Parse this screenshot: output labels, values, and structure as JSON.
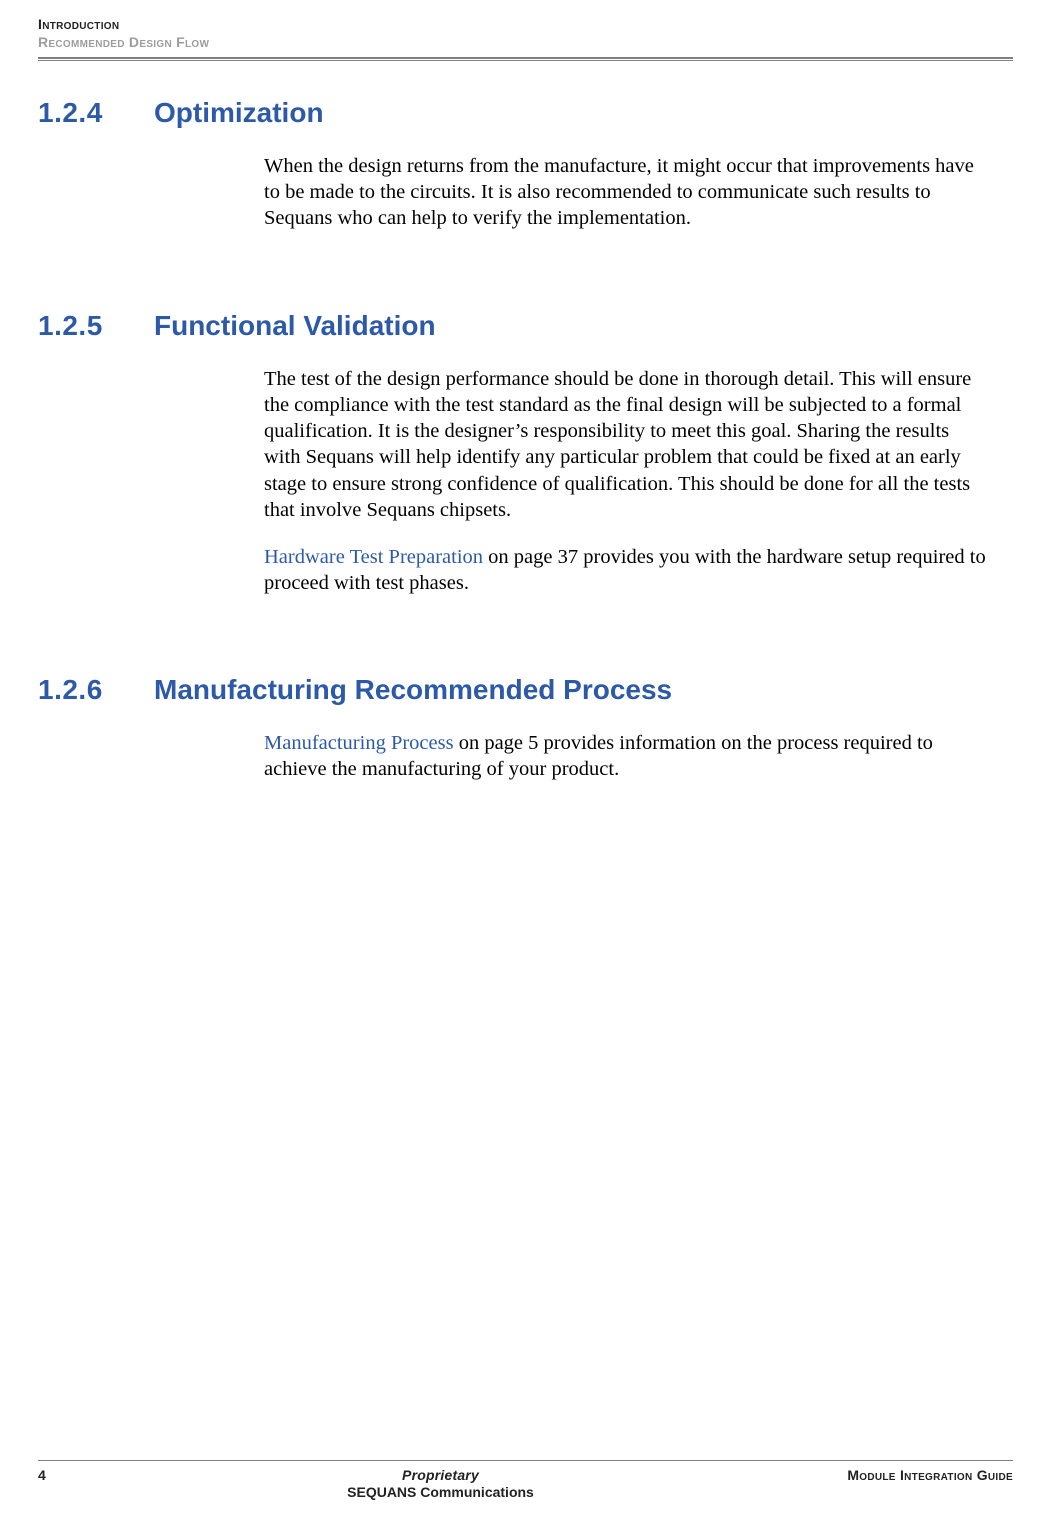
{
  "running_head": {
    "line1": "Introduction",
    "line2": "Recommended Design Flow"
  },
  "sections": {
    "s124": {
      "num": "1.2.4",
      "title": "Optimization",
      "p1": "When the design returns from the manufacture, it might occur that improvements have to be made to the circuits. It is also recommended to communicate such results to Sequans who can help to verify the implementation."
    },
    "s125": {
      "num": "1.2.5",
      "title": "Functional Validation",
      "p1": "The test of the design performance should be done in thorough detail. This will ensure the compliance with the test standard as the final design will be subjected to a formal qualification. It is the designer’s responsibility to meet this goal. Sharing the results with Sequans will help identify any particular problem that could be fixed at an early stage to ensure strong confidence of qualification. This should be done for all the tests that involve Sequans chipsets.",
      "p2_pre": " ",
      "p2_link": "Hardware Test Preparation",
      "p2_post": " on page 37 provides you with the hardware setup required to proceed with test phases."
    },
    "s126": {
      "num": "1.2.6",
      "title": "Manufacturing Recommended Process",
      "p1_pre": " ",
      "p1_link": "Manufacturing Process",
      "p1_post": " on page 5 provides information on the process required to achieve the manufacturing of your product."
    }
  },
  "footer": {
    "page_number": "4",
    "proprietary": "Proprietary",
    "company": "SEQUANS Communications",
    "doc_title": "Module Integration Guide"
  }
}
